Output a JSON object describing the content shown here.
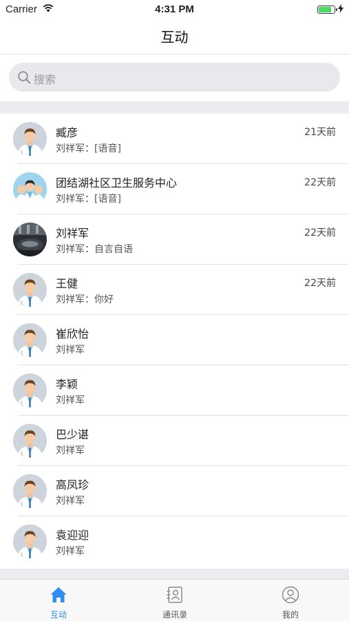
{
  "status_bar": {
    "carrier": "Carrier",
    "time": "4:31 PM",
    "battery_level": 0.85
  },
  "nav": {
    "title": "互动"
  },
  "search": {
    "placeholder": "搜索"
  },
  "conversations": [
    {
      "name": "臧彦",
      "message": "刘祥军：[语音]",
      "time": "21天前",
      "avatar": "doctor"
    },
    {
      "name": "团结湖社区卫生服务中心",
      "message": "刘祥军：[语音]",
      "time": "22天前",
      "avatar": "group"
    },
    {
      "name": "刘祥军",
      "message": "刘祥军：自言自语",
      "time": "22天前",
      "avatar": "photo"
    },
    {
      "name": "王健",
      "message": "刘祥军：你好",
      "time": "22天前",
      "avatar": "doctor"
    },
    {
      "name": "崔欣怡",
      "message": "刘祥军",
      "time": "",
      "avatar": "doctor"
    },
    {
      "name": "李颖",
      "message": "刘祥军",
      "time": "",
      "avatar": "doctor"
    },
    {
      "name": "巴少谌",
      "message": "刘祥军",
      "time": "",
      "avatar": "doctor"
    },
    {
      "name": "高凤珍",
      "message": "刘祥军",
      "time": "",
      "avatar": "doctor"
    },
    {
      "name": "袁迎迎",
      "message": "刘祥军",
      "time": "",
      "avatar": "doctor"
    }
  ],
  "tabs": [
    {
      "label": "互动",
      "icon": "home-icon",
      "active": true
    },
    {
      "label": "通讯录",
      "icon": "contacts-icon",
      "active": false
    },
    {
      "label": "我的",
      "icon": "profile-icon",
      "active": false
    }
  ],
  "colors": {
    "accent": "#2f8df0",
    "battery": "#4cd964",
    "background_gray": "#ebebf0"
  }
}
